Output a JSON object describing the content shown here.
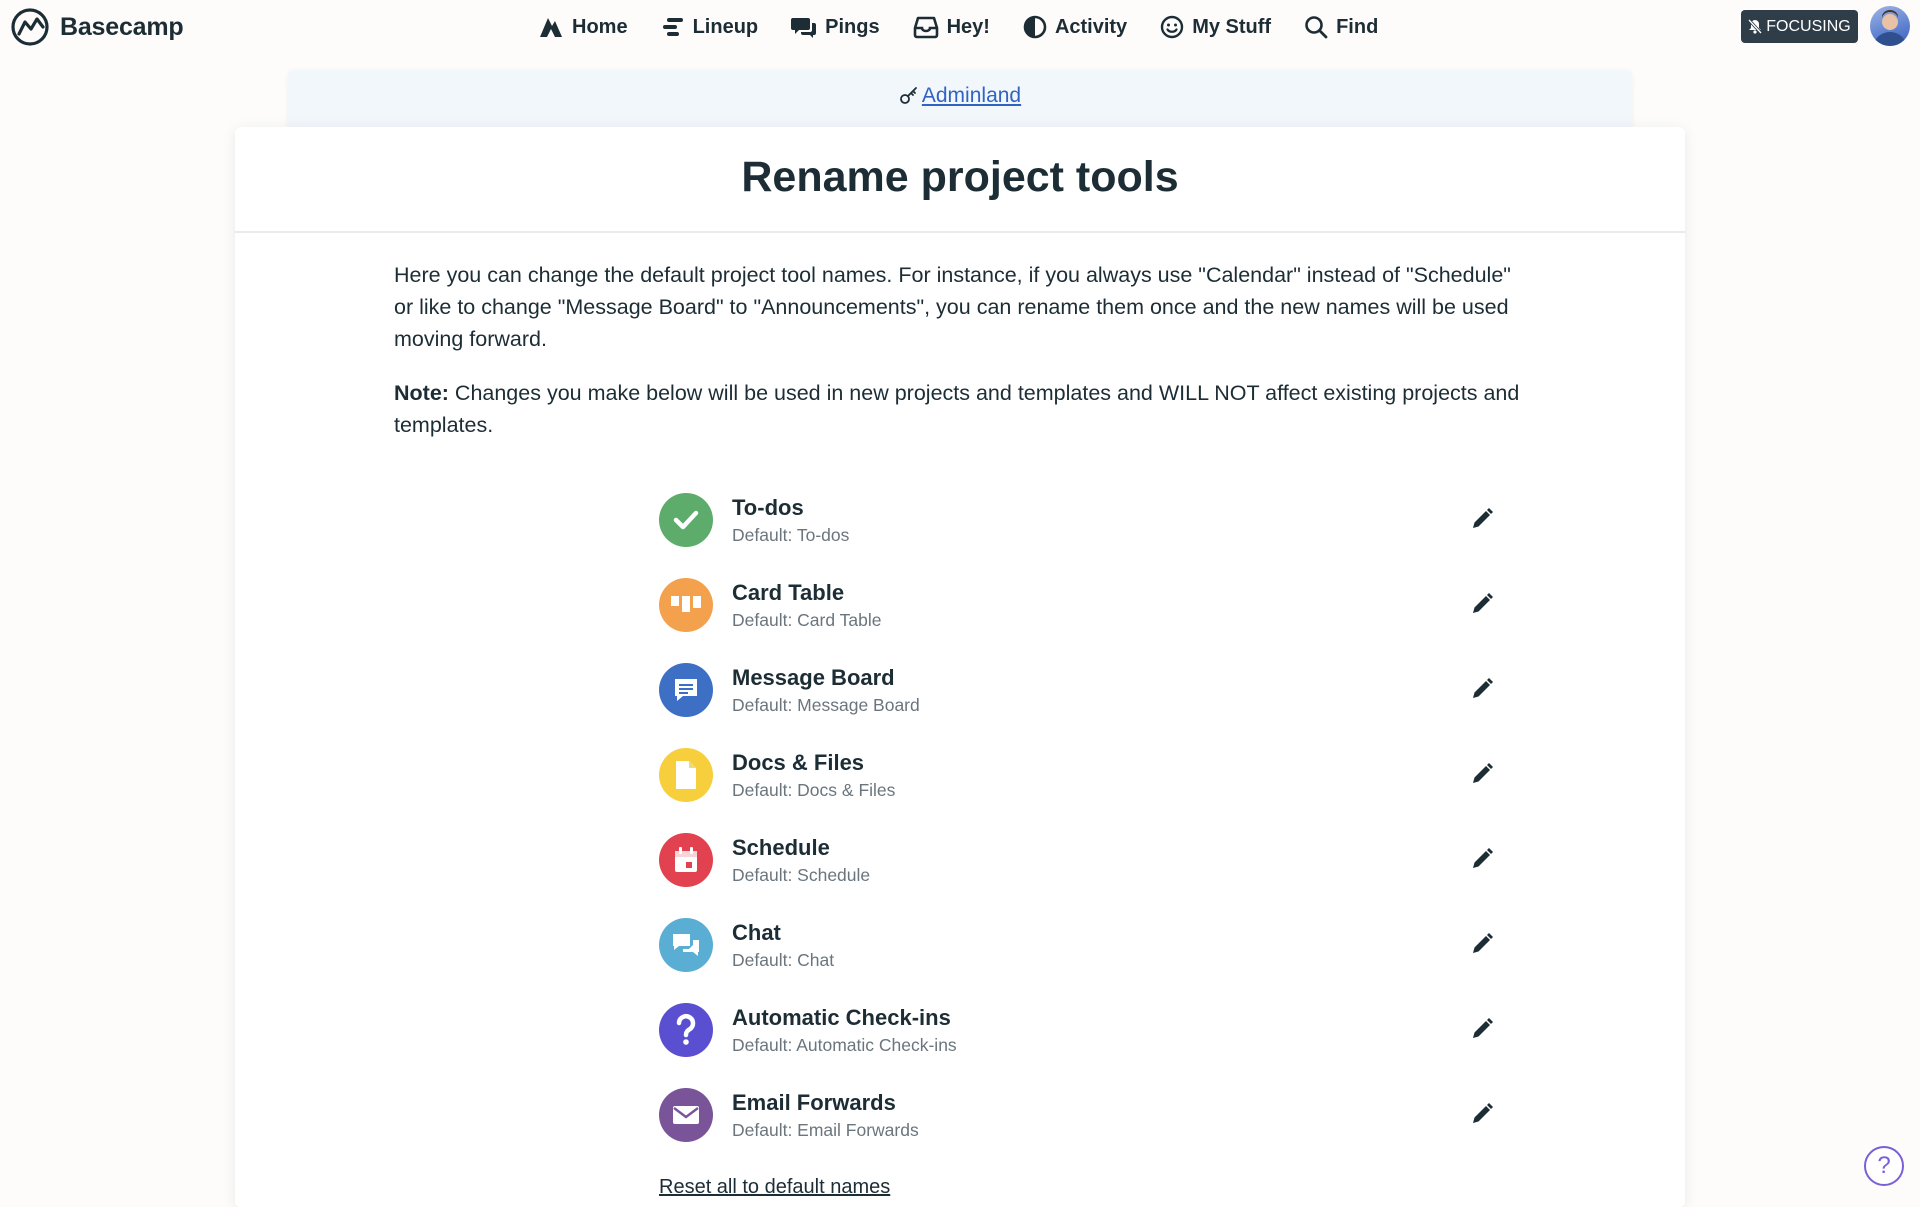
{
  "brand": {
    "name": "Basecamp"
  },
  "nav": {
    "items": [
      {
        "label": "Home",
        "icon": "home-icon"
      },
      {
        "label": "Lineup",
        "icon": "lineup-icon"
      },
      {
        "label": "Pings",
        "icon": "pings-icon"
      },
      {
        "label": "Hey!",
        "icon": "hey-inbox-icon"
      },
      {
        "label": "Activity",
        "icon": "activity-icon"
      },
      {
        "label": "My Stuff",
        "icon": "smiley-icon"
      },
      {
        "label": "Find",
        "icon": "search-icon"
      }
    ]
  },
  "status": {
    "focus_label": "FOCUSING"
  },
  "breadcrumb": {
    "label": "Adminland"
  },
  "page": {
    "title": "Rename project tools",
    "intro": "Here you can change the default project tool names. For instance, if you always use \"Calendar\" instead of \"Schedule\" or like to change \"Message Board\" to \"Announcements\", you can rename them once and the new names will be used moving forward.",
    "note_label": "Note:",
    "note_text": " Changes you make below will be used in new projects and templates and WILL NOT affect existing projects and templates."
  },
  "tools": [
    {
      "name": "To-dos",
      "default": "Default: To-dos",
      "icon": "check-icon",
      "color": "#5dac6b"
    },
    {
      "name": "Card Table",
      "default": "Default: Card Table",
      "icon": "card-table-icon",
      "color": "#f3a14d"
    },
    {
      "name": "Message Board",
      "default": "Default: Message Board",
      "icon": "message-icon",
      "color": "#3d6fc4"
    },
    {
      "name": "Docs & Files",
      "default": "Default: Docs & Files",
      "icon": "document-icon",
      "color": "#f7cf3d"
    },
    {
      "name": "Schedule",
      "default": "Default: Schedule",
      "icon": "calendar-icon",
      "color": "#e2414f"
    },
    {
      "name": "Chat",
      "default": "Default: Chat",
      "icon": "chat-icon",
      "color": "#5aaed3"
    },
    {
      "name": "Automatic Check-ins",
      "default": "Default: Automatic Check-ins",
      "icon": "question-icon",
      "color": "#5b4fd1"
    },
    {
      "name": "Email Forwards",
      "default": "Default: Email Forwards",
      "icon": "envelope-icon",
      "color": "#7a5499"
    }
  ],
  "actions": {
    "reset_label": "Reset all to default names",
    "help_label": "?"
  }
}
